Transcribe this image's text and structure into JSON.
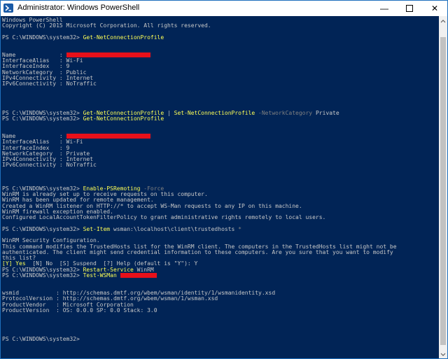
{
  "window": {
    "title": "Administrator: Windows PowerShell",
    "controls": {
      "minimize": "—",
      "close": "✕"
    }
  },
  "console": {
    "lines": [
      [
        {
          "t": "Windows PowerShell"
        }
      ],
      [
        {
          "t": "Copyright (C) 2015 Microsoft Corporation. All rights reserved."
        }
      ],
      [
        {
          "t": ""
        }
      ],
      [
        {
          "t": "PS C:\\WINDOWS\\system32> "
        },
        {
          "t": "Get-NetConnectionProfile",
          "c": "cmd"
        }
      ],
      [
        {
          "t": ""
        }
      ],
      [
        {
          "t": ""
        }
      ],
      [
        {
          "t": "Name             : "
        },
        {
          "redact": true
        }
      ],
      [
        {
          "t": "InterfaceAlias   : Wi-Fi"
        }
      ],
      [
        {
          "t": "InterfaceIndex   : 9"
        }
      ],
      [
        {
          "t": "NetworkCategory  : Public"
        }
      ],
      [
        {
          "t": "IPv4Connectivity : Internet"
        }
      ],
      [
        {
          "t": "IPv6Connectivity : NoTraffic"
        }
      ],
      [
        {
          "t": ""
        }
      ],
      [
        {
          "t": ""
        }
      ],
      [
        {
          "t": ""
        }
      ],
      [
        {
          "t": ""
        }
      ],
      [
        {
          "t": "PS C:\\WINDOWS\\system32> "
        },
        {
          "t": "Get-NetConnectionProfile",
          "c": "cmd"
        },
        {
          "t": " | "
        },
        {
          "t": "Set-NetConnectionProfile",
          "c": "cmd"
        },
        {
          "t": " -NetworkCategory",
          "c": "param"
        },
        {
          "t": " Private"
        }
      ],
      [
        {
          "t": "PS C:\\WINDOWS\\system32> "
        },
        {
          "t": "Get-NetConnectionProfile",
          "c": "cmd"
        }
      ],
      [
        {
          "t": ""
        }
      ],
      [
        {
          "t": ""
        }
      ],
      [
        {
          "t": "Name             : "
        },
        {
          "redact": true
        }
      ],
      [
        {
          "t": "InterfaceAlias   : Wi-Fi"
        }
      ],
      [
        {
          "t": "InterfaceIndex   : 9"
        }
      ],
      [
        {
          "t": "NetworkCategory  : Private"
        }
      ],
      [
        {
          "t": "IPv4Connectivity : Internet"
        }
      ],
      [
        {
          "t": "IPv6Connectivity : NoTraffic"
        }
      ],
      [
        {
          "t": ""
        }
      ],
      [
        {
          "t": ""
        }
      ],
      [
        {
          "t": ""
        }
      ],
      [
        {
          "t": "PS C:\\WINDOWS\\system32> "
        },
        {
          "t": "Enable-PSRemoting",
          "c": "cmd"
        },
        {
          "t": " -Force",
          "c": "param"
        }
      ],
      [
        {
          "t": "WinRM is already set up to receive requests on this computer."
        }
      ],
      [
        {
          "t": "WinRM has been updated for remote management."
        }
      ],
      [
        {
          "t": "Created a WinRM listener on HTTP://* to accept WS-Man requests to any IP on this machine."
        }
      ],
      [
        {
          "t": "WinRM firewall exception enabled."
        }
      ],
      [
        {
          "t": "Configured LocalAccountTokenFilterPolicy to grant administrative rights remotely to local users."
        }
      ],
      [
        {
          "t": ""
        }
      ],
      [
        {
          "t": "PS C:\\WINDOWS\\system32> "
        },
        {
          "t": "Set-Item",
          "c": "cmd"
        },
        {
          "t": " wsman:\\localhost\\client\\trustedhosts "
        },
        {
          "t": "*",
          "c": "param"
        }
      ],
      [
        {
          "t": ""
        }
      ],
      [
        {
          "t": "WinRM Security Configuration."
        }
      ],
      [
        {
          "t": "This command modifies the TrustedHosts list for the WinRM client. The computers in the TrustedHosts list might not be"
        }
      ],
      [
        {
          "t": "authenticated. The client might send credential information to these computers. Are you sure that you want to modify"
        }
      ],
      [
        {
          "t": "this list?"
        }
      ],
      [
        {
          "t": "[Y] Yes",
          "c": "yellow"
        },
        {
          "t": "  [N] No  [S] Suspend  [?] Help (default is \"Y\"): Y"
        }
      ],
      [
        {
          "t": "PS C:\\WINDOWS\\system32> "
        },
        {
          "t": "Restart-Service",
          "c": "cmd"
        },
        {
          "t": " WinRM"
        }
      ],
      [
        {
          "t": "PS C:\\WINDOWS\\system32> "
        },
        {
          "t": "Test-WSMan",
          "c": "cmd"
        },
        {
          "t": " "
        },
        {
          "redact": true
        }
      ],
      [
        {
          "t": ""
        }
      ],
      [
        {
          "t": ""
        }
      ],
      [
        {
          "t": "wsmid           : http://schemas.dmtf.org/wbem/wsman/identity/1/wsmanidentity.xsd"
        }
      ],
      [
        {
          "t": "ProtocolVersion : http://schemas.dmtf.org/wbem/wsman/1/wsman.xsd"
        }
      ],
      [
        {
          "t": "ProductVendor   : Microsoft Corporation"
        }
      ],
      [
        {
          "t": "ProductVersion  : OS: 0.0.0 SP: 0.0 Stack: 3.0"
        }
      ],
      [
        {
          "t": ""
        }
      ],
      [
        {
          "t": ""
        }
      ],
      [
        {
          "t": ""
        }
      ],
      [
        {
          "t": ""
        }
      ],
      [
        {
          "t": "PS C:\\WINDOWS\\system32> "
        }
      ]
    ]
  },
  "colors": {
    "console_background": "#012456",
    "console_text": "#c8c8c8",
    "command_highlight": "#ffff55",
    "parameter_text": "#808080",
    "redaction": "#e8101a"
  }
}
